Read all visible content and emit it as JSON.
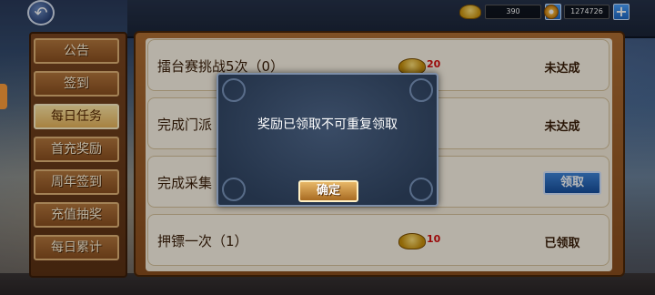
{
  "header": {
    "back_icon": "back-arrow-icon",
    "gold": "390",
    "coins": "1274726",
    "plus_label": "+"
  },
  "sidebar": {
    "items": [
      {
        "label": "公告"
      },
      {
        "label": "签到"
      },
      {
        "label": "每日任务",
        "active": true
      },
      {
        "label": "首充奖励"
      },
      {
        "label": "周年签到"
      },
      {
        "label": "充值抽奖"
      },
      {
        "label": "每日累计"
      }
    ]
  },
  "tasks": [
    {
      "title": "擂台赛挑战5次（0）",
      "reward": "20",
      "status": "未达成"
    },
    {
      "title": "完成门派",
      "reward": "",
      "status": "未达成"
    },
    {
      "title": "完成采集",
      "reward": "",
      "status": "领取"
    },
    {
      "title": "押镖一次（1）",
      "reward": "10",
      "status": "已领取"
    }
  ],
  "modal": {
    "message": "奖励已领取不可重复领取",
    "confirm_label": "确定"
  },
  "colors": {
    "panel": "#8a4e1e",
    "list_bg": "#f7eedb",
    "reward_red": "#d60f0f",
    "claim_blue": "#164f9e"
  }
}
